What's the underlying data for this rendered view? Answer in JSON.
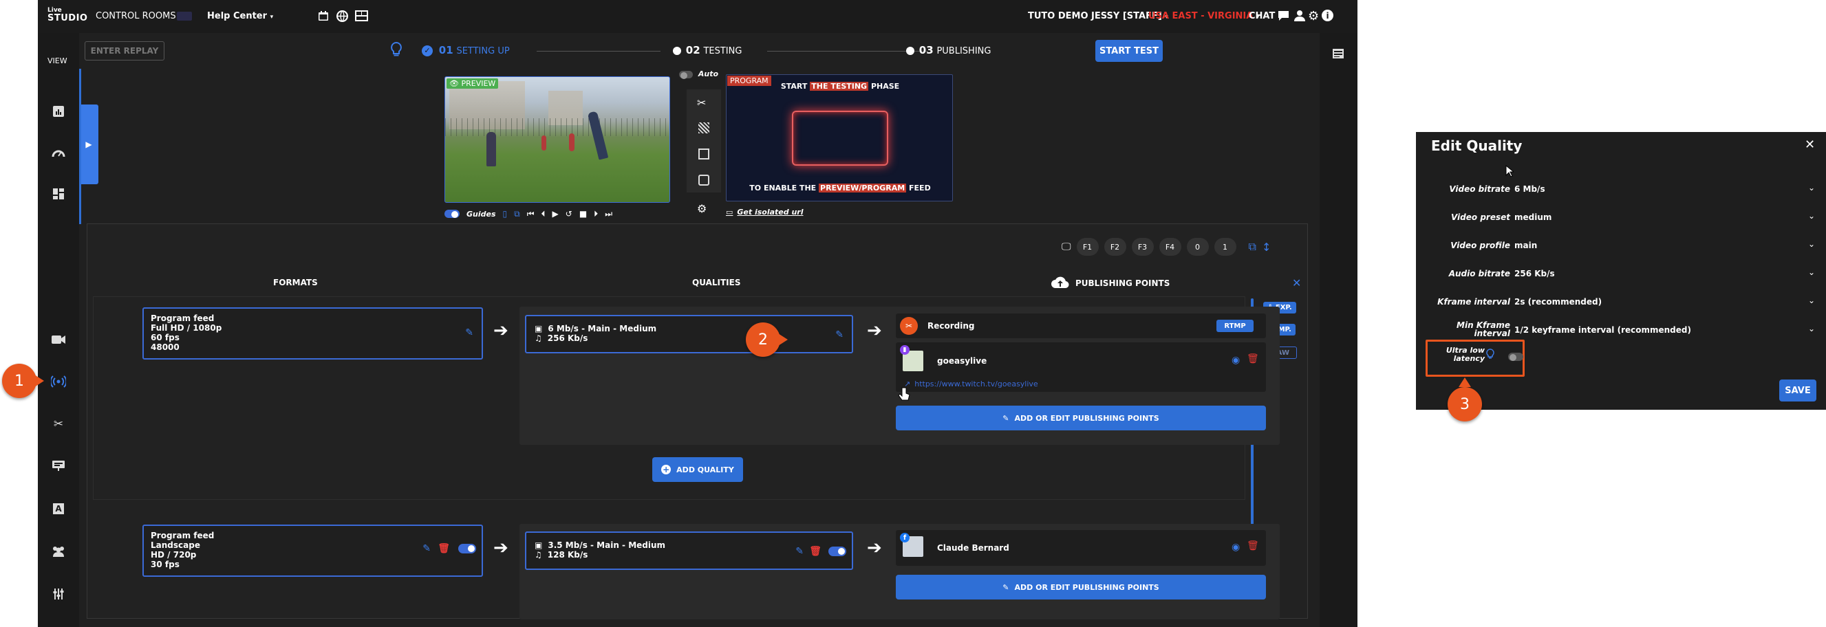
{
  "topbar": {
    "logo_top": "Live",
    "logo_bottom": "STUDIO",
    "control_rooms": "CONTROL ROOMS",
    "help_center": "Help Center",
    "user": "TUTO DEMO JESSY [STAFF]",
    "region": "USA EAST - VIRGINIA",
    "chat": "CHAT",
    "region_color": "#e8322a"
  },
  "sidebar": {
    "view_label": "VIEW"
  },
  "toolbar": {
    "enter_replay": "ENTER REPLAY",
    "start_test": "START TEST",
    "steps": [
      {
        "num": "01",
        "label": "SETTING UP"
      },
      {
        "num": "02",
        "label": "TESTING"
      },
      {
        "num": "03",
        "label": "PUBLISHING"
      }
    ]
  },
  "preview": {
    "badge": "PREVIEW",
    "guides_label": "Guides",
    "auto_label": "Auto"
  },
  "program": {
    "badge": "PROGRAM",
    "line1_pre": "START",
    "line1_hl": "THE TESTING",
    "line1_post": "PHASE",
    "line2_pre": "TO ENABLE THE",
    "line2_hl": "PREVIEW/PROGRAM",
    "line2_post": "FEED",
    "isolated_url": "Get isolated url"
  },
  "feed_controls": {
    "keys": [
      "F1",
      "F2",
      "F3",
      "F4",
      "0",
      "1"
    ]
  },
  "columns": {
    "formats": "FORMATS",
    "qualities": "QUALITIES",
    "publishing_points": "PUBLISHING POINTS"
  },
  "side_actions": {
    "exp": "EXP.",
    "imp": "IMP.",
    "raw": "RAW"
  },
  "feed1": {
    "title": "Program feed",
    "line2": "Full HD / 1080p",
    "line3": "60 fps",
    "line4": "48000",
    "quality_video": "6 Mb/s  -  Main  -  Medium",
    "quality_audio": "256 Kb/s",
    "pub1_name": "Recording",
    "pub1_badge": "RTMP",
    "pub2_name": "goeasylive",
    "pub2_url": "https://www.twitch.tv/goeasylive",
    "add_edit": "ADD OR EDIT PUBLISHING POINTS",
    "add_quality": "ADD QUALITY"
  },
  "feed2": {
    "title": "Program feed",
    "line2": "Landscape",
    "line3": "HD / 720p",
    "line4": "30 fps",
    "quality_video": "3.5 Mb/s  -  Main  -  Medium",
    "quality_audio": "128 Kb/s",
    "pub1_name": "Claude Bernard",
    "add_edit": "ADD OR EDIT PUBLISHING POINTS"
  },
  "callouts": [
    "1",
    "2",
    "3"
  ],
  "dialog": {
    "title": "Edit Quality",
    "rows": [
      {
        "label": "Video bitrate",
        "value": "6 Mb/s"
      },
      {
        "label": "Video preset",
        "value": "medium"
      },
      {
        "label": "Video profile",
        "value": "main"
      },
      {
        "label": "Audio bitrate",
        "value": "256 Kb/s"
      },
      {
        "label": "Kframe interval",
        "value": "2s (recommended)"
      },
      {
        "label_line1": "Min Kframe",
        "label_line2": "interval",
        "value": "1/2 keyframe interval (recommended)"
      }
    ],
    "ull_line1": "Ultra low",
    "ull_line2": "latency",
    "save": "SAVE"
  },
  "colors": {
    "accent": "#2f6fd6",
    "callout": "#e8551e",
    "danger": "#e53935"
  }
}
